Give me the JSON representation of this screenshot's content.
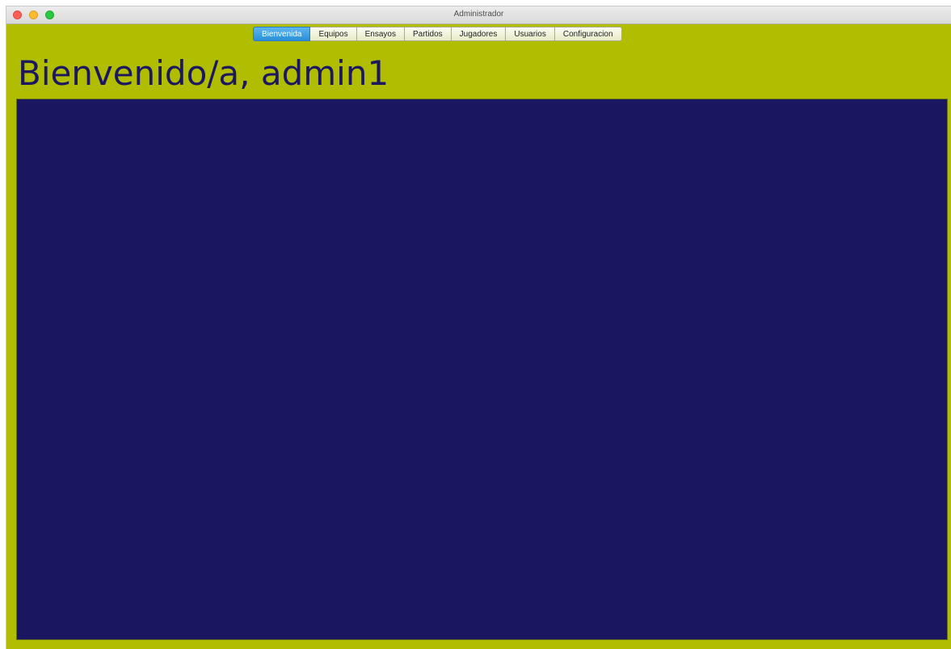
{
  "window": {
    "title": "Administrador"
  },
  "tabs": [
    {
      "label": "Bienvenida",
      "active": true
    },
    {
      "label": "Equipos",
      "active": false
    },
    {
      "label": "Ensayos",
      "active": false
    },
    {
      "label": "Partidos",
      "active": false
    },
    {
      "label": "Jugadores",
      "active": false
    },
    {
      "label": "Usuarios",
      "active": false
    },
    {
      "label": "Configuracion",
      "active": false
    }
  ],
  "main": {
    "greeting": "Bienvenido/a, admin1"
  },
  "colors": {
    "window_background": "#b1bd00",
    "content_panel": "#1b1660",
    "greeting_text": "#1b1760",
    "active_tab": "#2a8fd9"
  }
}
